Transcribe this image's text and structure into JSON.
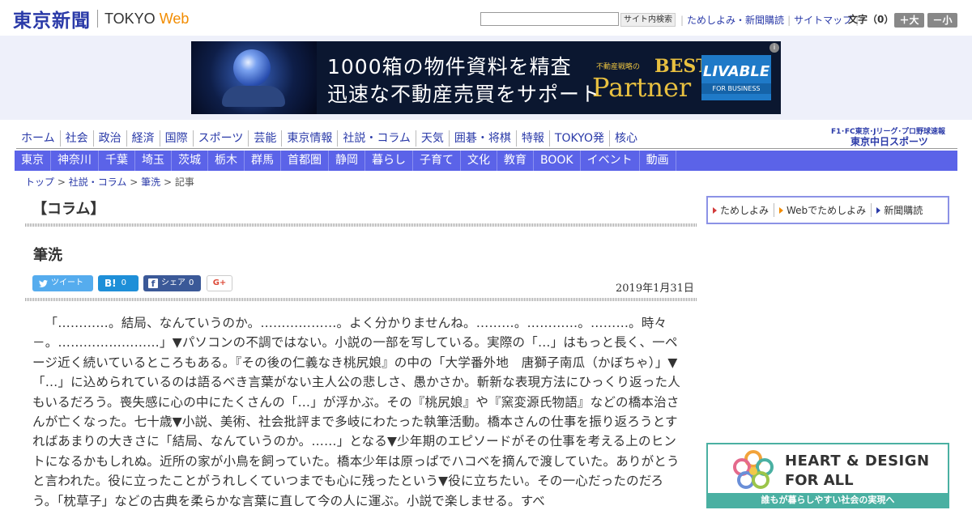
{
  "header": {
    "logo_kanji": "東京新聞",
    "logo_tokyo": "TOKYO",
    "logo_web": "Web",
    "search_button": "サイト内検索",
    "links": [
      "ためしよみ・新聞購読",
      "サイトマップ"
    ],
    "moji_label": "文字（0）",
    "size_up": "＋大",
    "size_down": "－小"
  },
  "ad": {
    "line1": "1000箱の物件資料を精査",
    "line2": "迅速な不動産売買をサポート",
    "best_small": "不動産戦略の",
    "best": "BEST",
    "partner": "Partner",
    "livable_big": "LIVABLE",
    "livable_small": "FOR BUSINESS",
    "info_icon": "i"
  },
  "nav_main": [
    "ホーム",
    "社会",
    "政治",
    "経済",
    "国際",
    "スポーツ",
    "芸能",
    "東京情報",
    "社説・コラム",
    "天気",
    "囲碁・将棋",
    "特報",
    "TOKYO発",
    "核心"
  ],
  "chunichi": {
    "top": "F1･FC東京･Jリーグ･プロ野球速報",
    "logo": "東京中日スポーツ"
  },
  "nav_sub": [
    "東京",
    "神奈川",
    "千葉",
    "埼玉",
    "茨城",
    "栃木",
    "群馬",
    "首都圏",
    "静岡",
    "暮らし",
    "子育て",
    "文化",
    "教育",
    "BOOK",
    "イベント",
    "動画"
  ],
  "breadcrumb": {
    "top": "トップ",
    "section": "社説・コラム",
    "column": "筆洗",
    "current": "記事",
    "sep": ">"
  },
  "column_heading": "【コラム】",
  "article": {
    "title": "筆洗",
    "date": "2019年1月31日",
    "body": "「…………。結局、なんていうのか。………………。よく分かりませんね。………。…………。………。時々－。……………………」▼パソコンの不調ではない。小説の一部を写している。実際の「…」はもっと長く、一ページ近く続いているところもある。『その後の仁義なき桃尻娘』の中の「大学番外地　唐獅子南瓜（かぼちゃ）」▼「…」に込められているのは語るべき言葉がない主人公の悲しさ、愚かさか。斬新な表現方法にひっくり返った人もいるだろう。喪失感に心の中にたくさんの「…」が浮かぶ。その『桃尻娘』や『窯変源氏物語』などの橋本治さんが亡くなった。七十歳▼小説、美術、社会批評まで多岐にわたった執筆活動。橋本さんの仕事を振り返ろうとすればあまりの大きさに「結局、なんていうのか。……」となる▼少年期のエピソードがその仕事を考える上のヒントになるかもしれぬ。近所の家が小鳥を飼っていた。橋本少年は原っぱでハコベを摘んで渡していた。ありがとうと言われた。役に立ったことがうれしくていつまでも心に残ったという▼役に立ちたい。その一心だったのだろう。「枕草子」などの古典を柔らかな言葉に直して今の人に運ぶ。小説で楽しませる。すべ"
  },
  "social": {
    "tweet": "ツイート",
    "hatena_label": "B!",
    "hatena_count": "0",
    "fb_label": "シェア",
    "fb_count": "0",
    "gplus": "G+"
  },
  "sidebar": {
    "links": [
      "ためしよみ",
      "Webでためしよみ",
      "新聞購読"
    ],
    "banner_line1": "HEART & DESIGN",
    "banner_line2": "FOR ALL",
    "banner_bar": "誰もが暮らしやすい社会の実現へ"
  },
  "colors": {
    "brand_blue": "#2a3aa8",
    "nav_purple": "#5b63e8",
    "web_orange": "#f28c00",
    "banner_teal": "#4ab0a2"
  }
}
